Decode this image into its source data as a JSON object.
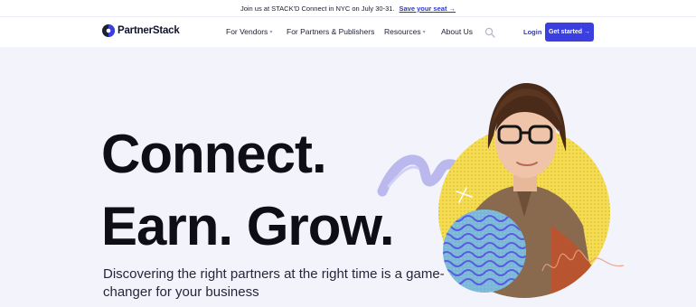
{
  "announcement": {
    "text": "Join us at STACK'D Connect in NYC on July 30-31.",
    "link": "Save your seat →"
  },
  "brand": {
    "name": "PartnerStack",
    "accent": "#3b3fe0"
  },
  "nav": {
    "items": [
      {
        "label": "For Vendors",
        "dropdown": true
      },
      {
        "label": "For Partners & Publishers",
        "dropdown": false
      },
      {
        "label": "Resources",
        "dropdown": true
      },
      {
        "label": "About Us",
        "dropdown": false
      }
    ],
    "search_icon": "search-icon",
    "login": "Login",
    "cta": "Get started →"
  },
  "hero": {
    "line1": "Connect.",
    "line2": "Earn. Grow.",
    "subtitle": "Discovering the right partners at the right time is a game-changer for your business"
  },
  "colors": {
    "background": "#f3f3fb",
    "yellow_circle": "#f2d84a",
    "teal_circle": "#3fd0b8",
    "lavender": "#a9a6e8",
    "purple_wave": "#5a5ae0"
  }
}
